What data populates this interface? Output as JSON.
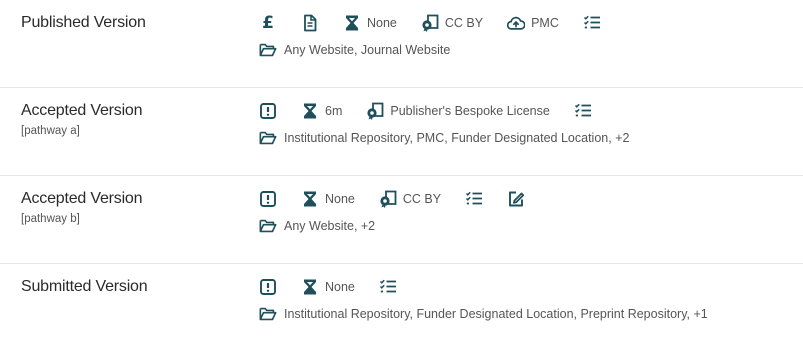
{
  "colors": {
    "icon": "#1e4f5b",
    "text": "#555555",
    "title": "#2a2a2a",
    "divider": "#e4e4e4"
  },
  "rows": [
    {
      "title": "Published Version",
      "subtitle": "",
      "embargo": "None",
      "license": "CC BY",
      "deposit": "PMC",
      "fee_icon": "£",
      "locations": "Any Website, Journal Website"
    },
    {
      "title": "Accepted Version",
      "subtitle": "[pathway a]",
      "embargo": "6m",
      "license": "Publisher's Bespoke License",
      "locations": "Institutional Repository, PMC, Funder Designated Location, +2"
    },
    {
      "title": "Accepted Version",
      "subtitle": "[pathway b]",
      "embargo": "None",
      "license": "CC BY",
      "locations": "Any Website, +2"
    },
    {
      "title": "Submitted Version",
      "subtitle": "",
      "embargo": "None",
      "locations": "Institutional Repository, Funder Designated Location, Preprint Repository, +1"
    }
  ]
}
